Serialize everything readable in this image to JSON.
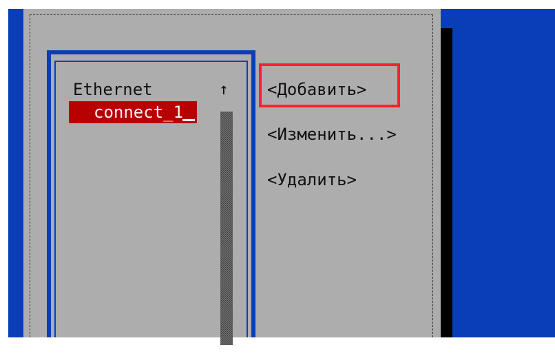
{
  "window": {
    "type": "terminal-dialog"
  },
  "connections": {
    "category": "Ethernet",
    "selected_item": "connect_1",
    "scroll_up_symbol": "↑"
  },
  "actions": {
    "add_label": "<Добавить>",
    "edit_label": "<Изменить...>",
    "delete_label": "<Удалить>"
  },
  "highlight": {
    "color": "#ff1f2d"
  },
  "colors": {
    "terminal_blue": "#0a3eb8",
    "dialog_gray": "#adadad",
    "selection_red": "#b80000",
    "shadow_black": "#000000"
  },
  "icons": {
    "scroll_indicator": "arrow-up-icon",
    "scrollbar": "scrollbar-track"
  }
}
